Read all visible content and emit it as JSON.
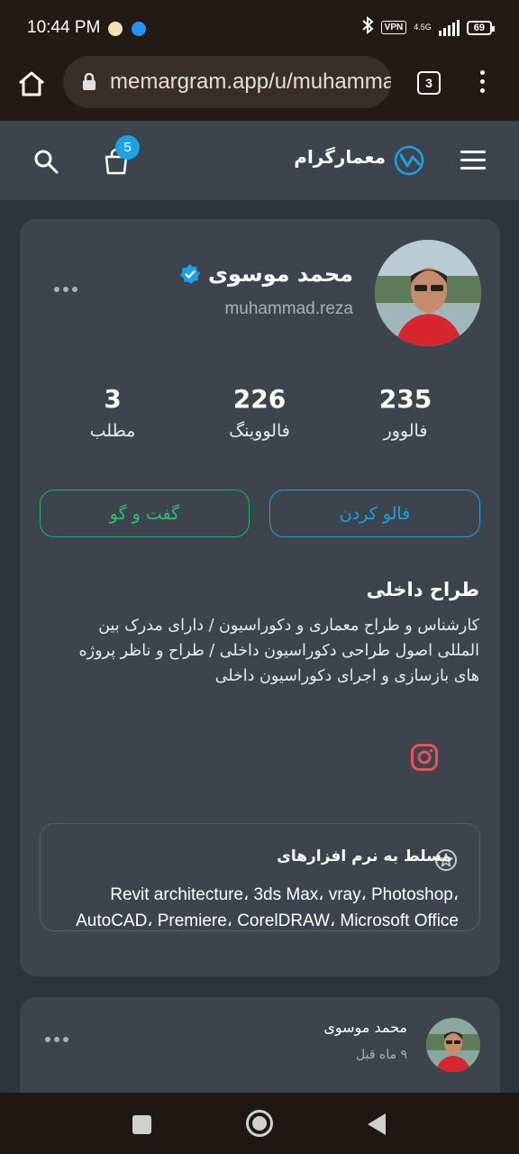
{
  "status_bar": {
    "time": "10:44 PM",
    "vpn": "VPN",
    "network": "4.5G",
    "battery": "69"
  },
  "browser": {
    "url": "memargram.app/u/muhammad.reza",
    "tab_count": "3"
  },
  "header": {
    "logo_text": "معمارگرام",
    "cart_count": "5",
    "brand_color": "#1aa3e3"
  },
  "profile": {
    "name": "محمد موسوی",
    "username": "muhammad.reza",
    "stats": {
      "followers_value": "235",
      "followers_label": "فالوور",
      "following_value": "226",
      "following_label": "فالووینگ",
      "posts_value": "3",
      "posts_label": "مطلب"
    },
    "follow_label": "فالو کردن",
    "chat_label": "گفت و گو",
    "bio_title": "طراح داخلی",
    "bio": "کارشناس و طراح معماری و دکوراسیون / دارای مدرک بین المللی اصول طراحی دکوراسیون داخلی / طراح و ناظر پروژه های بازسازی و اجرای دکوراسیون داخلی",
    "skills_title": "مسلط به نرم افزارهای",
    "skills": "Revit architecture، 3ds Max، vray، Photoshop، AutoCAD، Premiere، CorelDRAW، Microsoft Office"
  },
  "post": {
    "author": "محمد موسوی",
    "time": "۹ ماه قبل"
  }
}
